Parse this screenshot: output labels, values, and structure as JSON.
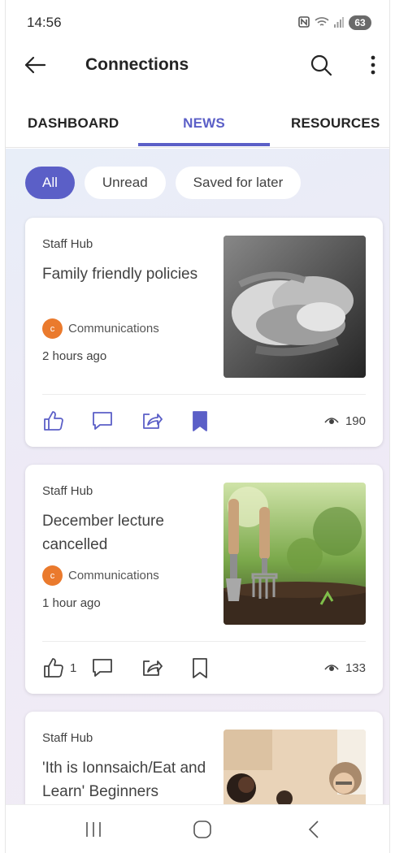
{
  "status_bar": {
    "time": "14:56",
    "battery": "63"
  },
  "header": {
    "title": "Connections"
  },
  "tabs": [
    {
      "label": "DASHBOARD"
    },
    {
      "label": "NEWS"
    },
    {
      "label": "RESOURCES"
    }
  ],
  "filters": [
    {
      "label": "All",
      "active": true
    },
    {
      "label": "Unread",
      "active": false
    },
    {
      "label": "Saved for later",
      "active": false
    }
  ],
  "cards": [
    {
      "source": "Staff Hub",
      "title": "Family friendly policies",
      "author_initial": "c",
      "author": "Communications",
      "time": "2 hours ago",
      "likes": "",
      "views": "190",
      "saved": true
    },
    {
      "source": "Staff Hub",
      "title": "December lecture cancelled",
      "author_initial": "c",
      "author": "Communications",
      "time": "1 hour ago",
      "likes": "1",
      "views": "133",
      "saved": false
    },
    {
      "source": "Staff Hub",
      "title": "'Ith is Ionnsaich/Eat and Learn' Beginners"
    }
  ],
  "colors": {
    "accent": "#5b5fc7",
    "avatar": "#ea7a2d"
  }
}
